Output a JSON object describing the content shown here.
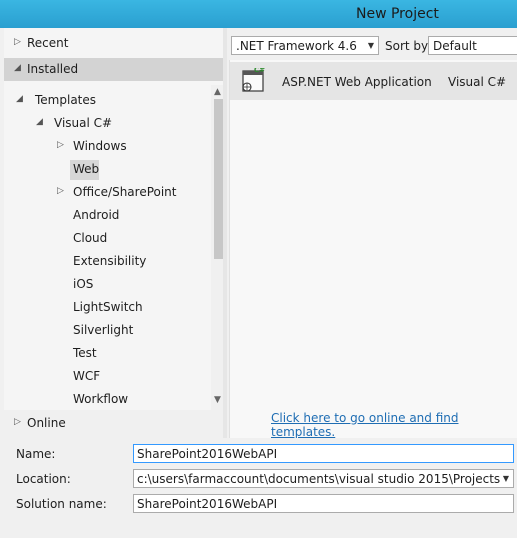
{
  "window": {
    "title": "New Project"
  },
  "left_nav": {
    "recent": "Recent",
    "installed": "Installed",
    "online": "Online",
    "tree": {
      "templates": "Templates",
      "visual_csharp": "Visual C#",
      "items": [
        "Windows",
        "Web",
        "Office/SharePoint",
        "Android",
        "Cloud",
        "Extensibility",
        "iOS",
        "LightSwitch",
        "Silverlight",
        "Test",
        "WCF",
        "Workflow"
      ],
      "selected": "Web"
    }
  },
  "toolbar": {
    "framework": ".NET Framework 4.6",
    "sort_label": "Sort by:",
    "sort_value": "Default"
  },
  "templates": [
    {
      "name": "ASP.NET Web Application",
      "language": "Visual C#"
    }
  ],
  "online_link": "Click here to go online and find templates.",
  "form": {
    "name_label": "Name:",
    "name_value": "SharePoint2016WebAPI",
    "location_label": "Location:",
    "location_value": "c:\\users\\farmaccount\\documents\\visual studio 2015\\Projects",
    "solution_label": "Solution name:",
    "solution_value": "SharePoint2016WebAPI"
  },
  "colors": {
    "titlebar": "#2aa3d4",
    "link": "#1e6db3",
    "selected": "#d7d7d7"
  }
}
